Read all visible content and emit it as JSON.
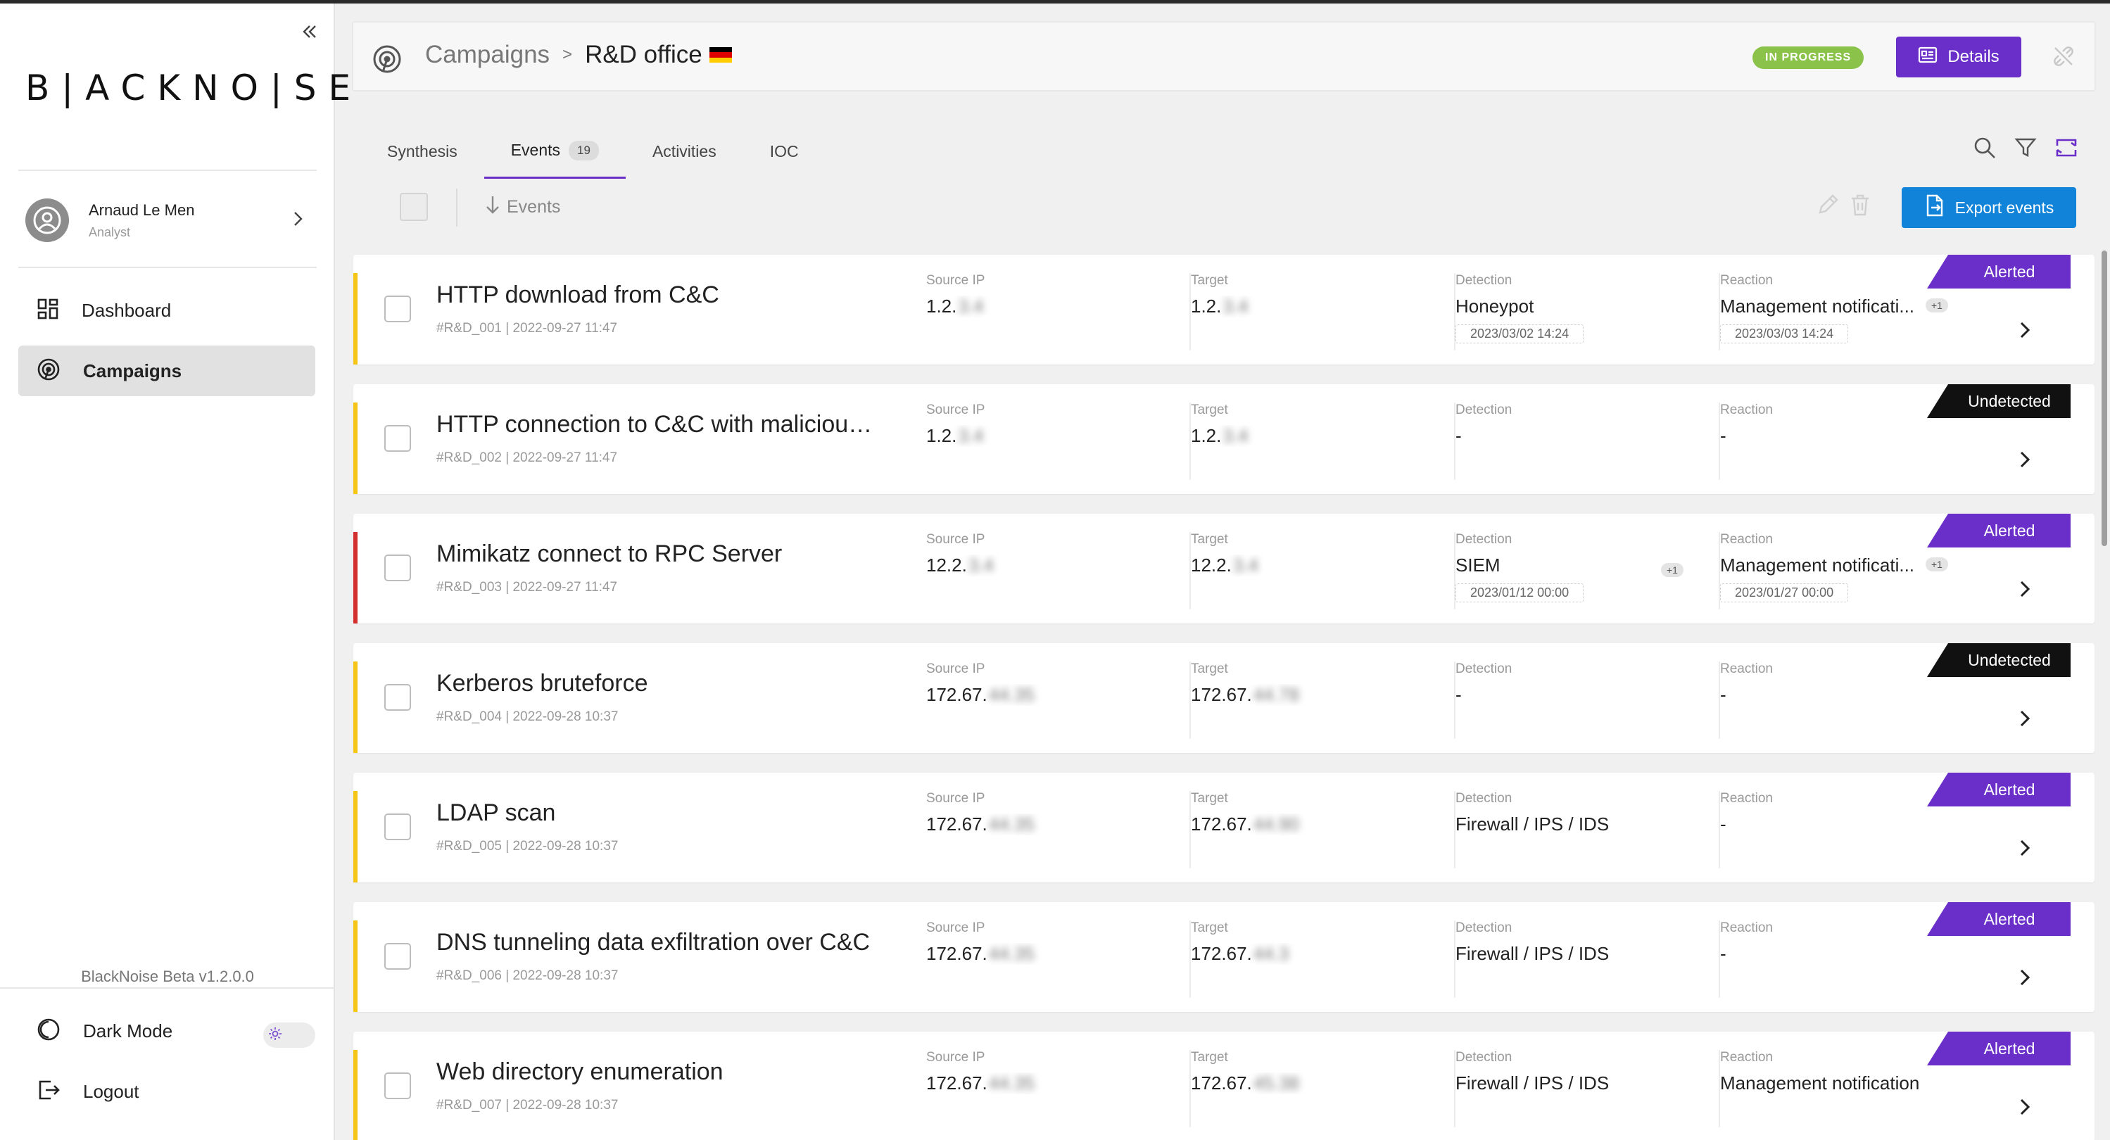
{
  "app": {
    "logo": "B|ACKNO|SE",
    "version": "BlackNoise Beta v1.2.0.0"
  },
  "user": {
    "name": "Arnaud Le Men",
    "role": "Analyst"
  },
  "nav": {
    "dashboard": "Dashboard",
    "campaigns": "Campaigns",
    "dark_mode": "Dark Mode",
    "logout": "Logout"
  },
  "header": {
    "breadcrumb_parent": "Campaigns",
    "breadcrumb_sep": ">",
    "breadcrumb_current": "R&D office",
    "status": "IN PROGRESS",
    "details_label": "Details"
  },
  "tabs": {
    "synthesis": "Synthesis",
    "events": "Events",
    "events_count": "19",
    "activities": "Activities",
    "ioc": "IOC"
  },
  "toolbar": {
    "sort_label": "Events",
    "export_label": "Export events"
  },
  "labels": {
    "source_ip": "Source IP",
    "target": "Target",
    "detection": "Detection",
    "reaction": "Reaction"
  },
  "colors": {
    "accent": "#6a2ec9",
    "export": "#1183d8",
    "in_progress": "#8bc34a",
    "stripe_warning": "#f5c518",
    "stripe_critical": "#d32f2f",
    "alerted": "#6a2ec9",
    "undetected": "#111111"
  },
  "events": [
    {
      "title": "HTTP download from C&C",
      "meta": "#R&D_001 | 2022-09-27 11:47",
      "source_ip": "1.2.",
      "source_ip_hidden": "3.4",
      "target": "1.2.",
      "target_hidden": "3.4",
      "detection": "Honeypot",
      "detection_date": "2023/03/02 14:24",
      "detection_extra": "",
      "reaction": "Management notificati...",
      "reaction_date": "2023/03/03 14:24",
      "reaction_extra": "+1",
      "status": "Alerted",
      "severity": "warning"
    },
    {
      "title": "HTTP connection to C&C with malicious...",
      "meta": "#R&D_002 | 2022-09-27 11:47",
      "source_ip": "1.2.",
      "source_ip_hidden": "3.4",
      "target": "1.2.",
      "target_hidden": "3.4",
      "detection": "-",
      "detection_date": "",
      "detection_extra": "",
      "reaction": "-",
      "reaction_date": "",
      "reaction_extra": "",
      "status": "Undetected",
      "severity": "warning"
    },
    {
      "title": "Mimikatz connect to RPC Server",
      "meta": "#R&D_003 | 2022-09-27 11:47",
      "source_ip": "12.2.",
      "source_ip_hidden": "3.4",
      "target": "12.2.",
      "target_hidden": "3.4",
      "detection": "SIEM",
      "detection_date": "2023/01/12 00:00",
      "detection_extra": "+1",
      "reaction": "Management notificati...",
      "reaction_date": "2023/01/27 00:00",
      "reaction_extra": "+1",
      "status": "Alerted",
      "severity": "critical"
    },
    {
      "title": "Kerberos bruteforce",
      "meta": "#R&D_004 | 2022-09-28 10:37",
      "source_ip": "172.67.",
      "source_ip_hidden": "44.35",
      "target": "172.67.",
      "target_hidden": "44.78",
      "detection": "-",
      "detection_date": "",
      "detection_extra": "",
      "reaction": "-",
      "reaction_date": "",
      "reaction_extra": "",
      "status": "Undetected",
      "severity": "warning"
    },
    {
      "title": "LDAP scan",
      "meta": "#R&D_005 | 2022-09-28 10:37",
      "source_ip": "172.67.",
      "source_ip_hidden": "44.35",
      "target": "172.67.",
      "target_hidden": "44.90",
      "detection": "Firewall / IPS / IDS",
      "detection_date": "",
      "detection_extra": "",
      "reaction": "-",
      "reaction_date": "",
      "reaction_extra": "",
      "status": "Alerted",
      "severity": "warning"
    },
    {
      "title": "DNS tunneling data exfiltration over C&C",
      "meta": "#R&D_006 | 2022-09-28 10:37",
      "source_ip": "172.67.",
      "source_ip_hidden": "44.35",
      "target": "172.67.",
      "target_hidden": "44.3",
      "detection": "Firewall / IPS / IDS",
      "detection_date": "",
      "detection_extra": "",
      "reaction": "-",
      "reaction_date": "",
      "reaction_extra": "",
      "status": "Alerted",
      "severity": "warning"
    },
    {
      "title": "Web directory enumeration",
      "meta": "#R&D_007 | 2022-09-28 10:37",
      "source_ip": "172.67.",
      "source_ip_hidden": "44.35",
      "target": "172.67.",
      "target_hidden": "45.38",
      "detection": "Firewall / IPS / IDS",
      "detection_date": "",
      "detection_extra": "",
      "reaction": "Management notification",
      "reaction_date": "",
      "reaction_extra": "",
      "status": "Alerted",
      "severity": "warning"
    }
  ]
}
